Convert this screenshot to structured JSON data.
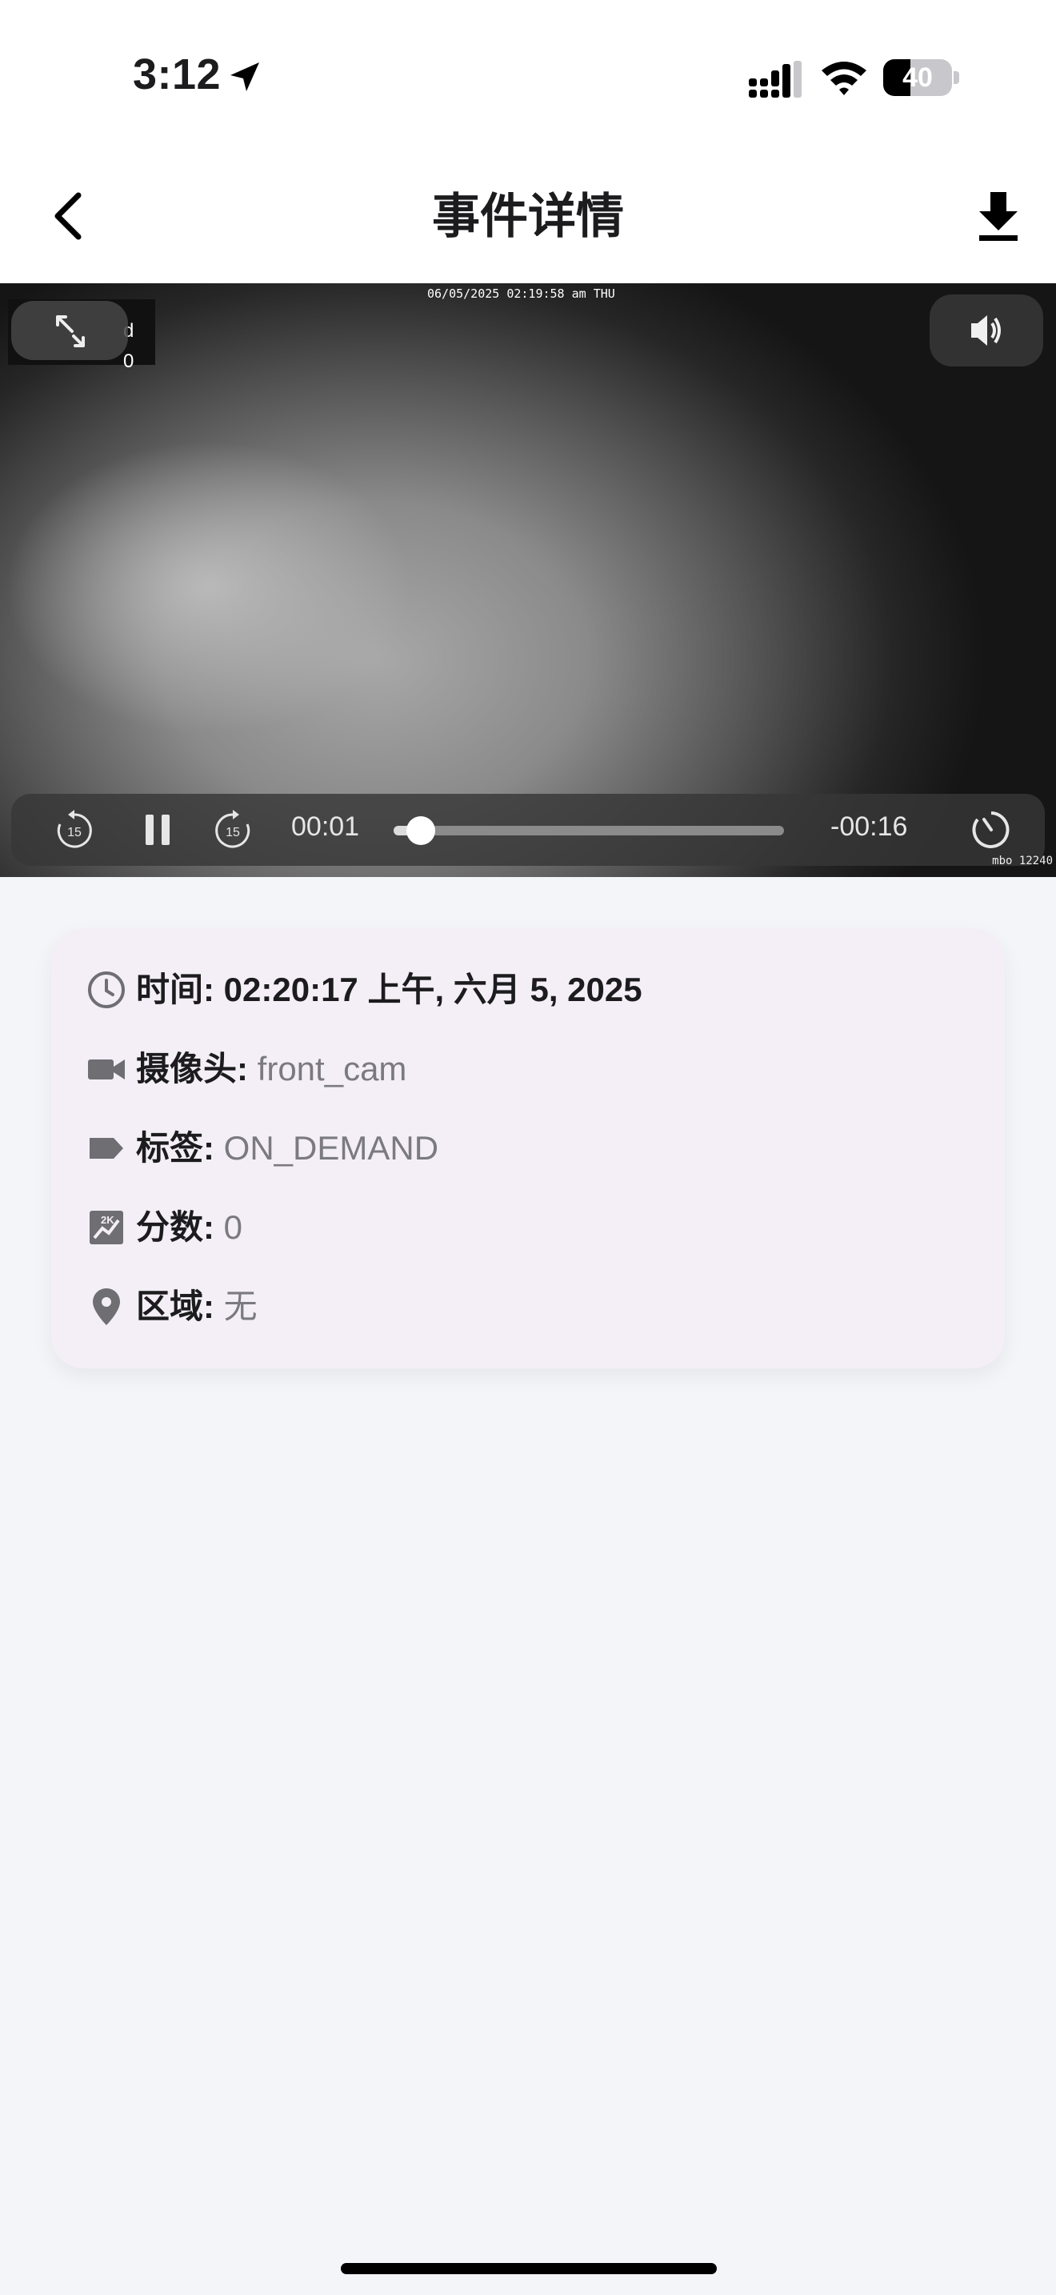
{
  "status_bar": {
    "time": "3:12",
    "battery": "40",
    "battery_level": 0.4
  },
  "header": {
    "title": "事件详情",
    "back_icon": "chevron-left-icon",
    "download_icon": "download-icon"
  },
  "video": {
    "osd_timestamp": "06/05/2025 02:19:58 am THU",
    "osd_line1": "d",
    "osd_line2": "0",
    "corner_label": "mbo 12240",
    "current_time": "00:01",
    "remaining_time": "-00:16",
    "progress": 0.07
  },
  "details": {
    "time": {
      "label": "时间:",
      "value": "02:20:17 上午, 六月 5, 2025",
      "icon": "clock-icon"
    },
    "camera": {
      "label": "摄像头:",
      "value": "front_cam",
      "icon": "video-camera-icon"
    },
    "tag": {
      "label": "标签:",
      "value": "ON_DEMAND",
      "icon": "label-icon"
    },
    "score": {
      "label": "分数:",
      "value": "0",
      "icon": "score-chart-icon"
    },
    "zone": {
      "label": "区域:",
      "value": "无",
      "icon": "location-pin-icon"
    }
  }
}
